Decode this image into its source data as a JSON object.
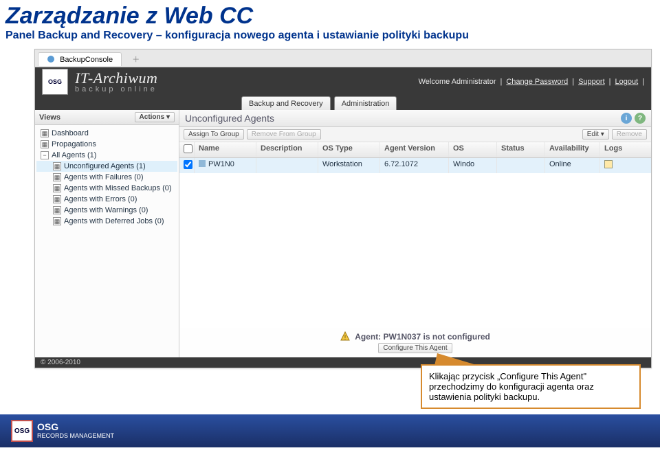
{
  "slide": {
    "title": "Zarządzanie z Web CC",
    "subtitle": "Panel Backup and Recovery – konfiguracja nowego agenta i ustawianie polityki backupu"
  },
  "tab": {
    "label": "BackupConsole"
  },
  "header": {
    "brand_line1": "IT-Archiwum",
    "brand_line2": "backup online",
    "welcome": "Welcome Administrator",
    "change_pw": "Change Password",
    "support": "Support",
    "logout": "Logout"
  },
  "main_tabs": {
    "backup": "Backup and Recovery",
    "admin": "Administration"
  },
  "sidebar": {
    "title": "Views",
    "actions": "Actions ▾",
    "items": [
      {
        "label": "Dashboard"
      },
      {
        "label": "Propagations"
      },
      {
        "label": "All Agents (1)"
      },
      {
        "label": "Unconfigured Agents (1)",
        "selected": true,
        "child": true
      },
      {
        "label": "Agents with Failures (0)",
        "child": true
      },
      {
        "label": "Agents with Missed Backups (0)",
        "child": true
      },
      {
        "label": "Agents with Errors (0)",
        "child": true
      },
      {
        "label": "Agents with Warnings (0)",
        "child": true
      },
      {
        "label": "Agents with Deferred Jobs (0)",
        "child": true
      }
    ]
  },
  "content": {
    "title": "Unconfigured Agents",
    "assign": "Assign To Group",
    "remove_group": "Remove From Group",
    "edit": "Edit ▾",
    "remove": "Remove",
    "columns": {
      "name": "Name",
      "desc": "Description",
      "ostype": "OS Type",
      "ver": "Agent Version",
      "os": "OS",
      "status": "Status",
      "avail": "Availability",
      "logs": "Logs"
    },
    "row": {
      "name": "PW1N0",
      "desc": "",
      "ostype": "Workstation",
      "ver": "6.72.1072",
      "os": "Windo",
      "status": "",
      "avail": "Online"
    },
    "alert": "Agent: PW1N037 is not configured",
    "configure": "Configure This Agent"
  },
  "footer": "© 2006-2010",
  "callout": "Klikając przycisk „Configure This Agent\" przechodzimy do konfiguracji agenta oraz ustawienia polityki backupu.",
  "footer_logo": {
    "brand": "OSG",
    "line1": "RECORDS",
    "line2": "MANAGEMENT"
  }
}
